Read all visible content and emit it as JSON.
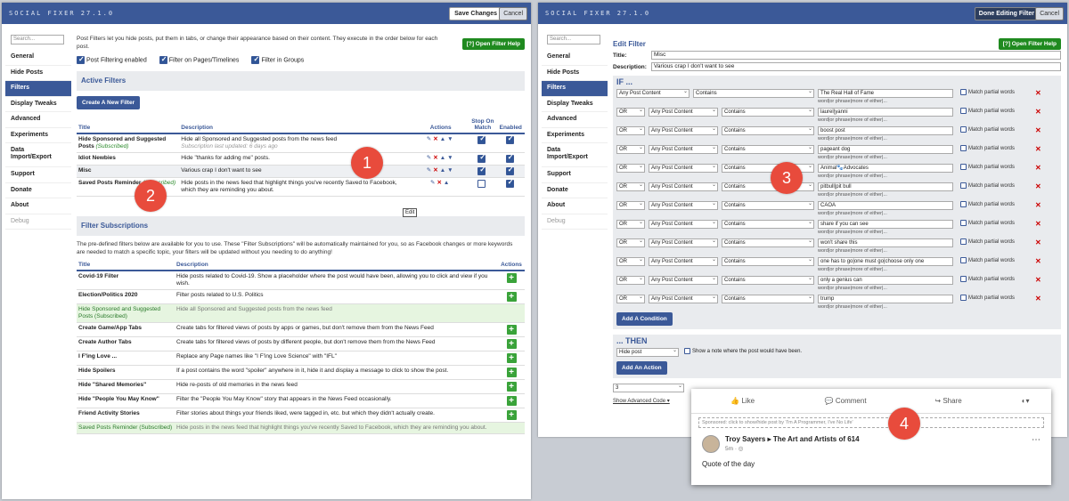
{
  "left": {
    "brand": "SOCIAL FIXER 27.1.0",
    "save_label": "Save Changes",
    "cancel_label": "Cancel",
    "search_placeholder": "Search...",
    "nav": [
      "General",
      "Hide Posts",
      "Filters",
      "Display Tweaks",
      "Advanced",
      "Experiments",
      "Data Import/Export",
      "Support",
      "Donate",
      "About",
      "Debug"
    ],
    "intro": "Post Filters let you hide posts, put them in tabs, or change their appearance based on their content. They execute in the order below for each post.",
    "help_label": "[?] Open Filter Help",
    "checks": [
      "Post Filtering enabled",
      "Filter on Pages/Timelines",
      "Filter in Groups"
    ],
    "active_filters_title": "Active Filters",
    "create_label": "Create A New Filter",
    "table_headers": {
      "title": "Title",
      "description": "Description",
      "actions": "Actions",
      "stop": "Stop On Match",
      "enabled": "Enabled"
    },
    "filters": [
      {
        "title": "Hide Sponsored and Suggested Posts",
        "tag": "(Subscribed)",
        "desc": "Hide all Sponsored and Suggested posts from the news feed",
        "note": "Subscription last updated: 6 days ago",
        "stop": true,
        "enabled": true
      },
      {
        "title": "Idiot Newbies",
        "tag": "",
        "desc": "Hide \"thanks for adding me\" posts.",
        "note": "",
        "stop": true,
        "enabled": true
      },
      {
        "title": "Misc",
        "tag": "",
        "desc": "Various crap I don't want to see",
        "note": "",
        "stop": true,
        "enabled": true
      },
      {
        "title": "Saved Posts Reminder",
        "tag": "(Subscribed)",
        "desc": "Hide posts in the news feed that highlight things you've recently Saved to Facebook, which they are reminding you about.",
        "note": "",
        "stop": false,
        "enabled": true
      }
    ],
    "tooltip": "Edit",
    "subs_title": "Filter Subscriptions",
    "subs_intro": "The pre-defined filters below are available for you to use. These \"Filter Subscriptions\" will be automatically maintained for you, so as Facebook changes or more keywords are needed to match a specific topic, your filters will be updated without you needing to do anything!",
    "subscriptions": [
      {
        "title": "Covid-19 Filter",
        "desc": "Hide posts related to Covid-19. Show a placeholder where the post would have been, allowing you to click and view if you wish.",
        "subscribed": false
      },
      {
        "title": "Election/Politics 2020",
        "desc": "Filter posts related to U.S. Politics",
        "subscribed": false
      },
      {
        "title": "Hide Sponsored and Suggested Posts (Subscribed)",
        "desc": "Hide all Sponsored and Suggested posts from the news feed",
        "subscribed": true
      },
      {
        "title": "Create Game/App Tabs",
        "desc": "Create tabs for filtered views of posts by apps or games, but don't remove them from the News Feed",
        "subscribed": false
      },
      {
        "title": "Create Author Tabs",
        "desc": "Create tabs for filtered views of posts by different people, but don't remove them from the News Feed",
        "subscribed": false
      },
      {
        "title": "I F'ing Love ...",
        "desc": "Replace any Page names like \"I F'ing Love Science\" with \"IFL\"",
        "subscribed": false
      },
      {
        "title": "Hide Spoilers",
        "desc": "If a post contains the word \"spoiler\" anywhere in it, hide it and display a message to click to show the post.",
        "subscribed": false
      },
      {
        "title": "Hide \"Shared Memories\"",
        "desc": "Hide re-posts of old memories in the news feed",
        "subscribed": false
      },
      {
        "title": "Hide \"People You May Know\"",
        "desc": "Filter the \"People You May Know\" story that appears in the News Feed occasionally.",
        "subscribed": false
      },
      {
        "title": "Friend Activity Stories",
        "desc": "Filter stories about things your friends liked, were tagged in, etc. but which they didn't actually create.",
        "subscribed": false
      },
      {
        "title": "Saved Posts Reminder (Subscribed)",
        "desc": "Hide posts in the news feed that highlight things you've recently Saved to Facebook, which they are reminding you about.",
        "subscribed": true
      }
    ]
  },
  "right": {
    "brand": "SOCIAL FIXER 27.1.0",
    "done_label": "Done Editing Filter",
    "cancel_label": "Cancel",
    "search_placeholder": "Search...",
    "help_label": "[?] Open Filter Help",
    "edit_title": "Edit Filter",
    "title_label": "Title:",
    "title_value": "Misc",
    "desc_label": "Description:",
    "desc_value": "Various crap I don't want to see",
    "if_label": "IF ...",
    "hint": "word|or phrase|more of either|...",
    "match_partial": "Match partial words",
    "conditions": [
      {
        "op": "",
        "field": "Any Post Content",
        "cmp": "Contains",
        "value": "The Real Hall of Fame"
      },
      {
        "op": "OR",
        "field": "Any Post Content",
        "cmp": "Contains",
        "value": "laurel|yanni"
      },
      {
        "op": "OR",
        "field": "Any Post Content",
        "cmp": "Contains",
        "value": "boost post"
      },
      {
        "op": "OR",
        "field": "Any Post Content",
        "cmp": "Contains",
        "value": "pageant dog"
      },
      {
        "op": "OR",
        "field": "Any Post Content",
        "cmp": "Contains",
        "value": "Animal🐾Advocates"
      },
      {
        "op": "OR",
        "field": "Any Post Content",
        "cmp": "Contains",
        "value": "pitbull|pit bull"
      },
      {
        "op": "OR",
        "field": "Any Post Content",
        "cmp": "Contains",
        "value": "CAOA"
      },
      {
        "op": "OR",
        "field": "Any Post Content",
        "cmp": "Contains",
        "value": "share if you can see"
      },
      {
        "op": "OR",
        "field": "Any Post Content",
        "cmp": "Contains",
        "value": "won't share this"
      },
      {
        "op": "OR",
        "field": "Any Post Content",
        "cmp": "Contains",
        "value": "one has to go|one must go|choose only one"
      },
      {
        "op": "OR",
        "field": "Any Post Content",
        "cmp": "Contains",
        "value": "only a genius can"
      },
      {
        "op": "OR",
        "field": "Any Post Content",
        "cmp": "Contains",
        "value": "trump"
      }
    ],
    "add_condition": "Add A Condition",
    "then_label": "... THEN",
    "action_value": "Hide post",
    "show_note": "Show a note where the post would have been.",
    "add_action": "Add An Action",
    "number_value": "3",
    "advanced_link": "Show Advanced Code ▾"
  },
  "fb": {
    "like": "Like",
    "comment": "Comment",
    "share": "Share",
    "sponsored_note": "Sponsored: click to show/hide post by 'I'm A Programmer, I've No Life'",
    "poster": "Troy Sayers ▸ The Art and Artists of 614",
    "time": "5m · ◎",
    "text": "Quote of the day"
  },
  "badges": [
    "1",
    "2",
    "3",
    "4"
  ]
}
